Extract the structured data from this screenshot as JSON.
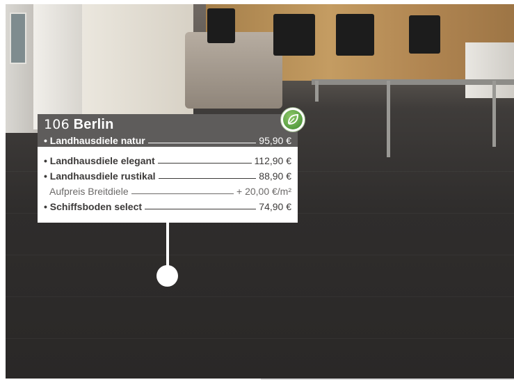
{
  "product": {
    "number": "106",
    "name": "Berlin",
    "header_row": {
      "label": "• Landhausdiele natur",
      "price": "95,90 €"
    },
    "rows": [
      {
        "label": "• Landhausdiele elegant",
        "price": "112,90 €",
        "style": "bold"
      },
      {
        "label": "• Landhausdiele rustikal",
        "price": "88,90 €",
        "style": "bold"
      },
      {
        "label": "Aufpreis Breitdiele",
        "price": "+ 20,00 €/m²",
        "style": "light"
      },
      {
        "label": "• Schiffsboden select",
        "price": "74,90 €",
        "style": "bold"
      }
    ]
  },
  "badge": {
    "icon": "eco-leaf-icon",
    "color": "#4a9a36"
  },
  "colors": {
    "header_bg": "#5e5c5b",
    "body_bg": "#ffffff",
    "floor": "#2f2d2c"
  }
}
